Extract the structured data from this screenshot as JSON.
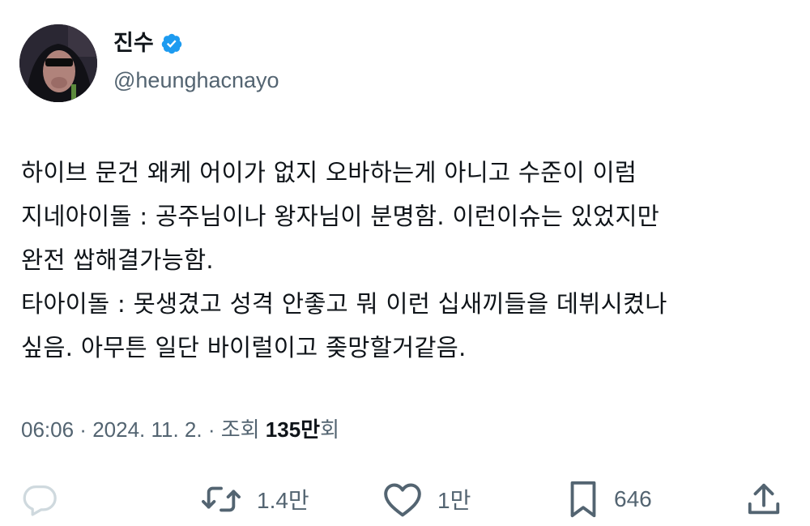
{
  "user": {
    "display_name": "진수",
    "handle": "@heunghacnayo",
    "verified_color": "#1d9bf0"
  },
  "tweet": {
    "lines": [
      "하이브 문건 왜케 어이가 없지 오바하는게 아니고 수준이 이럼",
      "지네아이돌 : 공주님이나 왕자님이 분명함. 이런이슈는 있었지만",
      "완전 쌉해결가능함.",
      "타아이돌 : 못생겼고 성격 안좋고 뭐 이런 십새끼들을 데뷔시켰나",
      "싶음. 아무튼 일단 바이럴이고 좆망할거같음."
    ]
  },
  "meta": {
    "time": "06:06",
    "sep1": " · ",
    "date": "2024. 11. 2.",
    "sep2": " · ",
    "views_label": "조회 ",
    "views_count": "135만",
    "views_suffix": "회"
  },
  "actions": {
    "reply_icon": "reply-icon",
    "retweet_icon": "retweet-icon",
    "retweet_count": "1.4만",
    "like_icon": "heart-icon",
    "like_count": "1만",
    "bookmark_icon": "bookmark-icon",
    "bookmark_count": "646",
    "share_icon": "share-icon"
  },
  "colors": {
    "text": "#0f1419",
    "secondary": "#536471",
    "reply_icon": "#cfd9de"
  }
}
